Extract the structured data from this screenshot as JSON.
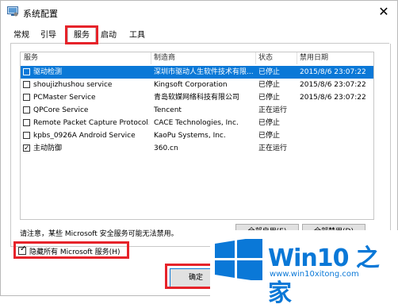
{
  "window": {
    "title": "系统配置",
    "close_glyph": "✕"
  },
  "tabs": [
    {
      "label": "常规"
    },
    {
      "label": "引导"
    },
    {
      "label": "服务",
      "active": true
    },
    {
      "label": "启动"
    },
    {
      "label": "工具"
    }
  ],
  "table": {
    "columns": [
      "服务",
      "制造商",
      "状态",
      "禁用日期"
    ],
    "rows": [
      {
        "checked": false,
        "service": "驱动检测",
        "maker": "深圳市驱动人生软件技术有限...",
        "status": "已停止",
        "date": "2015/8/6 23:07:22",
        "selected": true
      },
      {
        "checked": false,
        "service": "shoujizhushou service",
        "maker": "Kingsoft Corporation",
        "status": "已停止",
        "date": "2015/8/6 23:07:22"
      },
      {
        "checked": false,
        "service": "PCMaster Service",
        "maker": "青岛软媒网络科技有限公司",
        "status": "已停止",
        "date": "2015/8/6 23:07:22"
      },
      {
        "checked": false,
        "service": "QPCore Service",
        "maker": "Tencent",
        "status": "正在运行",
        "date": ""
      },
      {
        "checked": false,
        "service": "Remote Packet Capture Protocol...",
        "maker": "CACE Technologies, Inc.",
        "status": "已停止",
        "date": ""
      },
      {
        "checked": false,
        "service": "kpbs_0926A Android Service",
        "maker": "KaoPu Systems, Inc.",
        "status": "已停止",
        "date": ""
      },
      {
        "checked": true,
        "service": "主动防御",
        "maker": "360.cn",
        "status": "正在运行",
        "date": ""
      }
    ]
  },
  "note": "请注意，某些 Microsoft 安全服务可能无法禁用。",
  "buttons": {
    "enable_all": "全部启用(E)",
    "disable_all": "全部禁用(D)",
    "ok": "确定"
  },
  "hide_ms": {
    "label": "隐藏所有 Microsoft 服务(H)",
    "checked": true
  },
  "watermark": {
    "title": "Win10 之家",
    "url": "www.win10xitong.com"
  },
  "colors": {
    "selection": "#0a78d7",
    "highlight_box": "#e6232a",
    "brand_blue": "#0a78d7"
  }
}
